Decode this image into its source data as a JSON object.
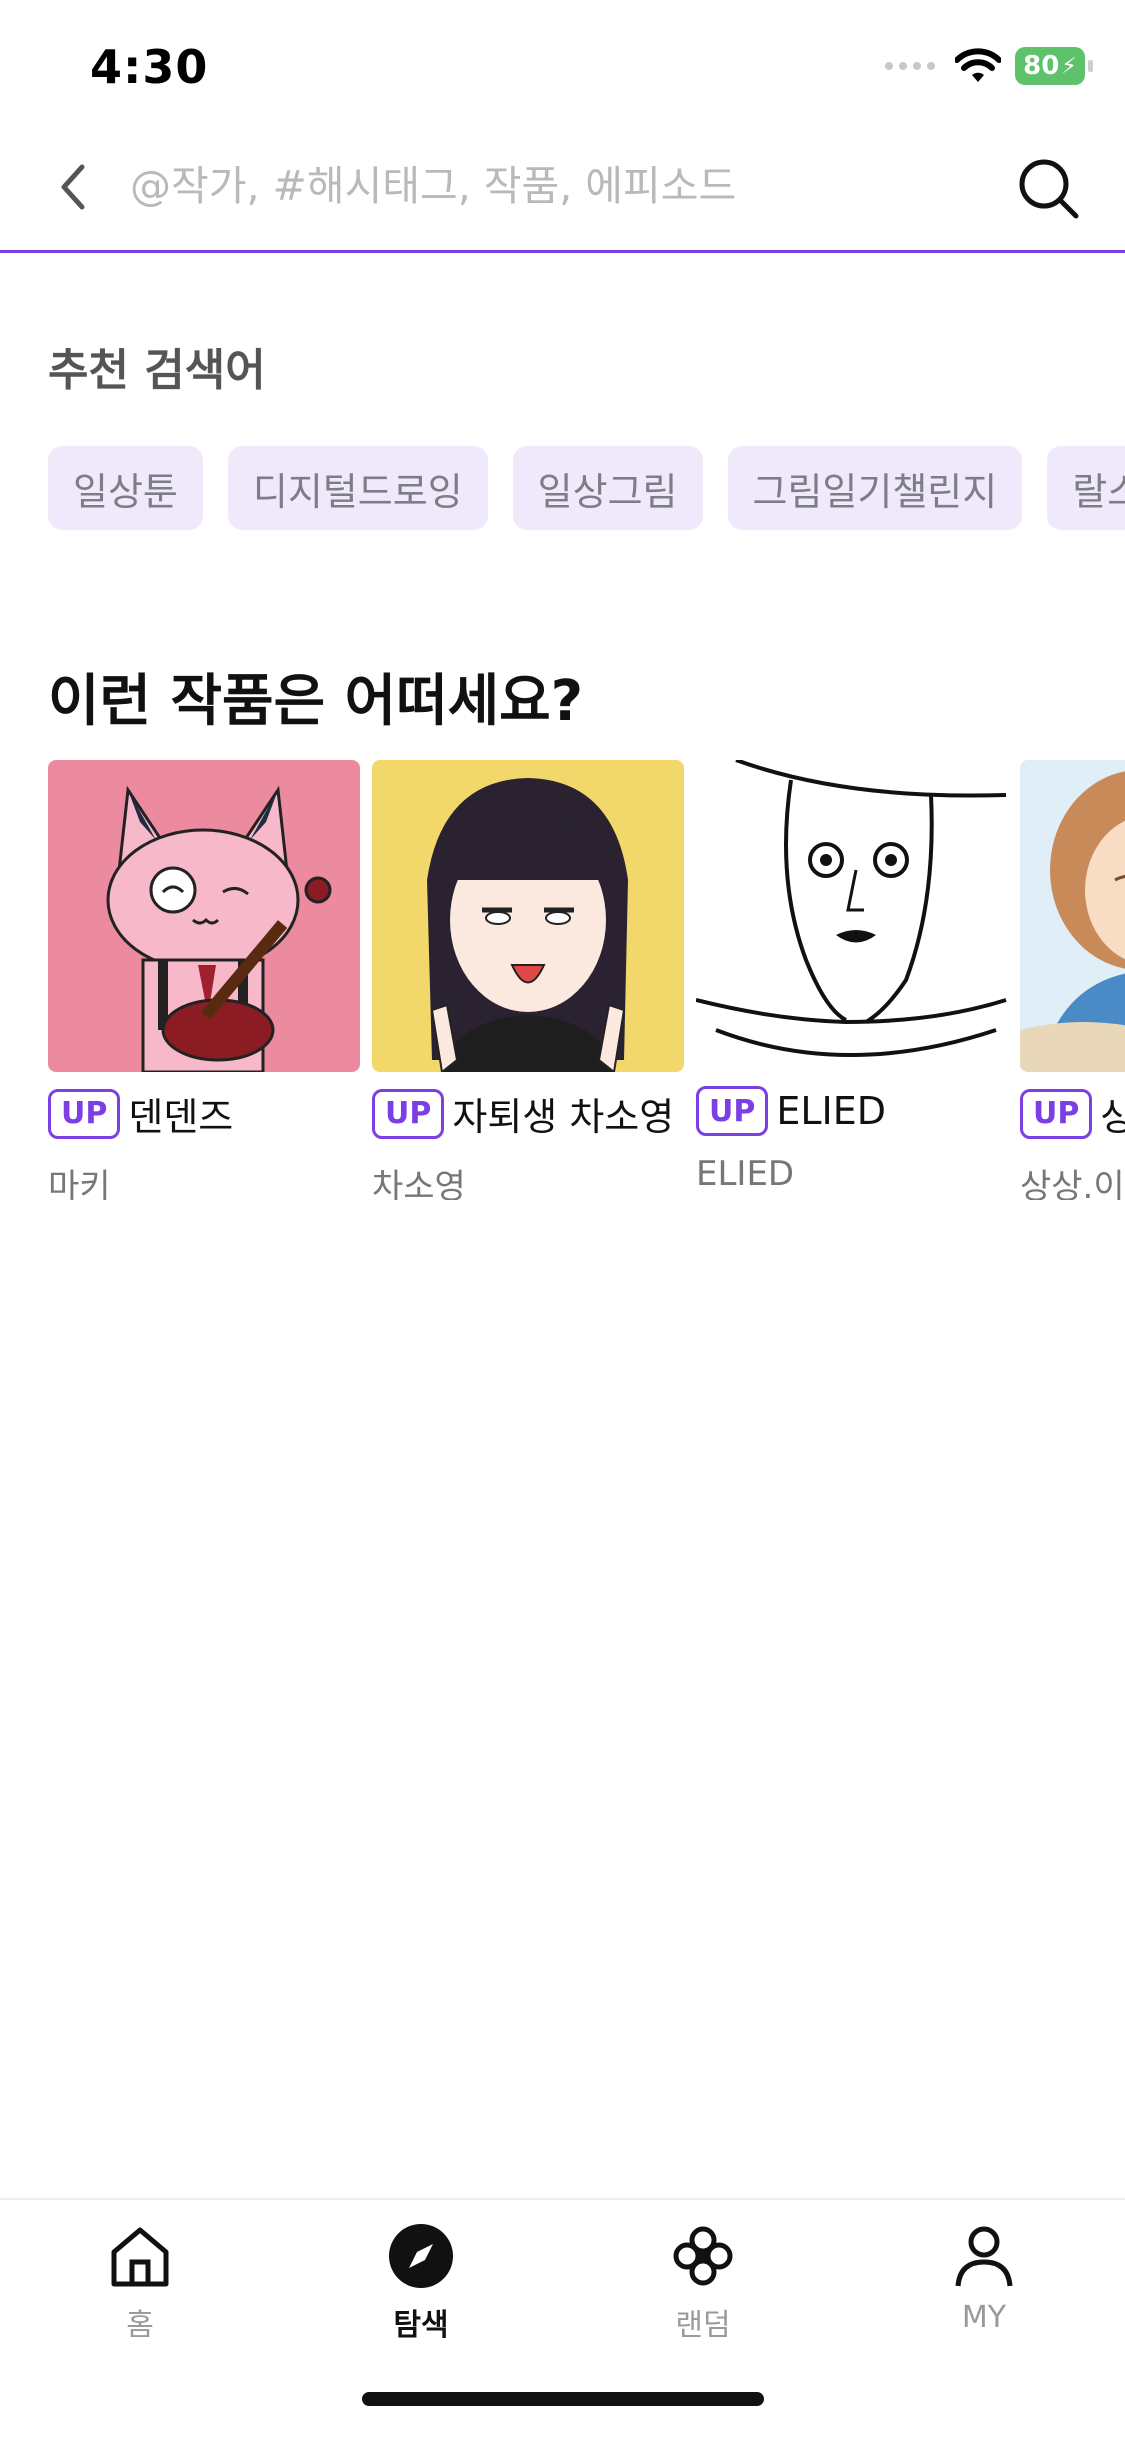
{
  "status_bar": {
    "time": "4:30",
    "battery": "80"
  },
  "search": {
    "placeholder": "@작가, #해시태그, 작품, 에피소드",
    "accent_color": "#7b3fe4"
  },
  "recommended_keywords": {
    "title": "추천 검색어",
    "chips": [
      "일상툰",
      "디지털드로잉",
      "일상그림",
      "그림일기챌린지",
      "랄스"
    ]
  },
  "recommended_works": {
    "title": "이런 작품은 어떠세요?",
    "badge": "UP",
    "items": [
      {
        "title": "덴덴즈",
        "author": "마키",
        "thumb": "pink-cat-guitar"
      },
      {
        "title": "자퇴생 차소영",
        "author": "차소영",
        "thumb": "girl-peace-sign"
      },
      {
        "title": "ELIED",
        "author": "ELIED",
        "thumb": "line-drawing-face"
      },
      {
        "title": "상",
        "author": "상상.이상",
        "thumb": "watercolor-girl"
      }
    ]
  },
  "bottom_nav": {
    "items": [
      {
        "label": "홈",
        "icon": "home-icon",
        "active": false
      },
      {
        "label": "탐색",
        "icon": "compass-icon",
        "active": true
      },
      {
        "label": "랜덤",
        "icon": "clover-icon",
        "active": false
      },
      {
        "label": "MY",
        "icon": "person-icon",
        "active": false
      }
    ]
  }
}
